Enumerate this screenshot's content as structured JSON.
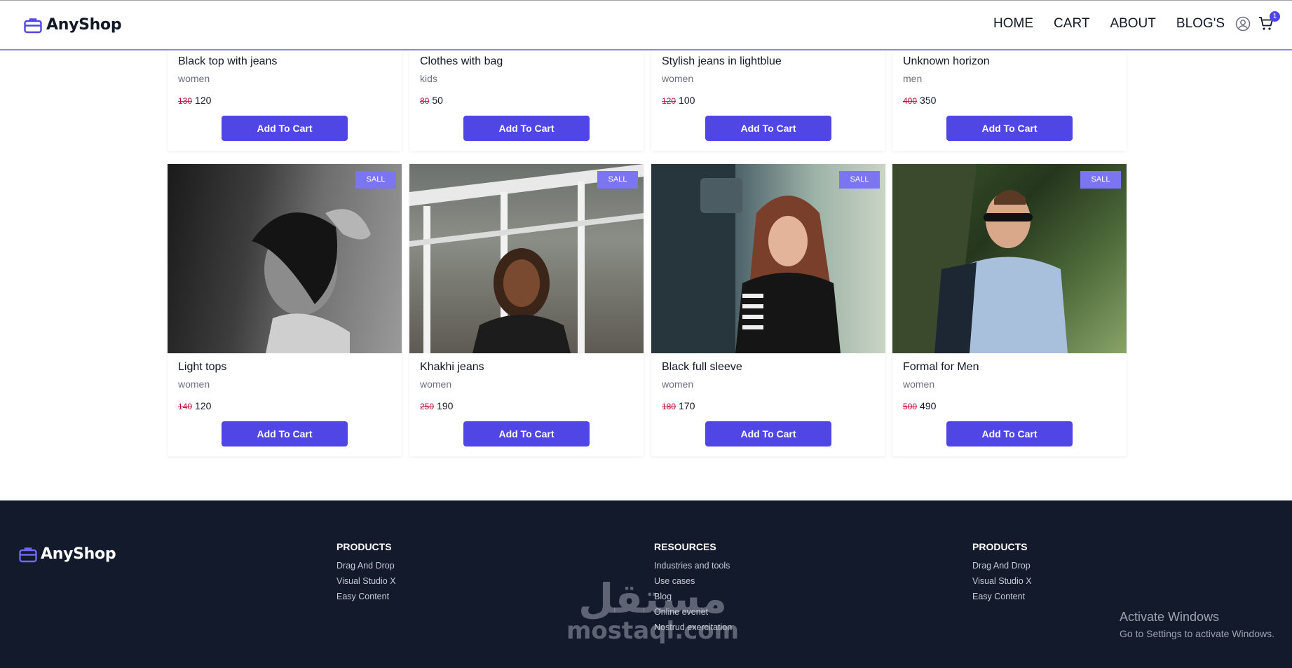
{
  "brand": {
    "name": "AnyShop",
    "logo_icon": "briefcase-icon",
    "accent": "#4f46e5"
  },
  "nav": {
    "links": [
      "HOME",
      "CART",
      "ABOUT",
      "BLOG'S"
    ],
    "cart_count": "1"
  },
  "products": [
    {
      "title": "Black top with jeans",
      "category": "women",
      "old_price": "130",
      "price": "120",
      "button": "Add To Cart"
    },
    {
      "title": "Clothes with bag",
      "category": "kids",
      "old_price": "80",
      "price": "50",
      "button": "Add To Cart"
    },
    {
      "title": "Stylish jeans in lightblue",
      "category": "women",
      "old_price": "120",
      "price": "100",
      "button": "Add To Cart"
    },
    {
      "title": "Unknown horizon",
      "category": "men",
      "old_price": "400",
      "price": "350",
      "button": "Add To Cart"
    },
    {
      "title": "Light tops",
      "category": "women",
      "old_price": "140",
      "price": "120",
      "button": "Add To Cart",
      "badge": "SALL"
    },
    {
      "title": "Khakhi jeans",
      "category": "women",
      "old_price": "250",
      "price": "190",
      "button": "Add To Cart",
      "badge": "SALL"
    },
    {
      "title": "Black full sleeve",
      "category": "women",
      "old_price": "180",
      "price": "170",
      "button": "Add To Cart",
      "badge": "SALL"
    },
    {
      "title": "Formal for Men",
      "category": "women",
      "old_price": "500",
      "price": "490",
      "button": "Add To Cart",
      "badge": "SALL"
    }
  ],
  "footer": {
    "brand": "AnyShop",
    "columns": [
      {
        "title": "PRODUCTS",
        "links": [
          "Drag And Drop",
          "Visual Studio X",
          "Easy Content"
        ]
      },
      {
        "title": "RESOURCES",
        "links": [
          "Industries and tools",
          "Use cases",
          "Blog",
          "Online evenet",
          "Nostrud exercitation"
        ]
      },
      {
        "title": "PRODUCTS",
        "links": [
          "Drag And Drop",
          "Visual Studio X",
          "Easy Content"
        ]
      }
    ]
  },
  "watermark": {
    "arabic": "مستقل",
    "latin": "mostaql.com"
  },
  "os_notice": {
    "line1": "Activate Windows",
    "line2": "Go to Settings to activate Windows."
  }
}
